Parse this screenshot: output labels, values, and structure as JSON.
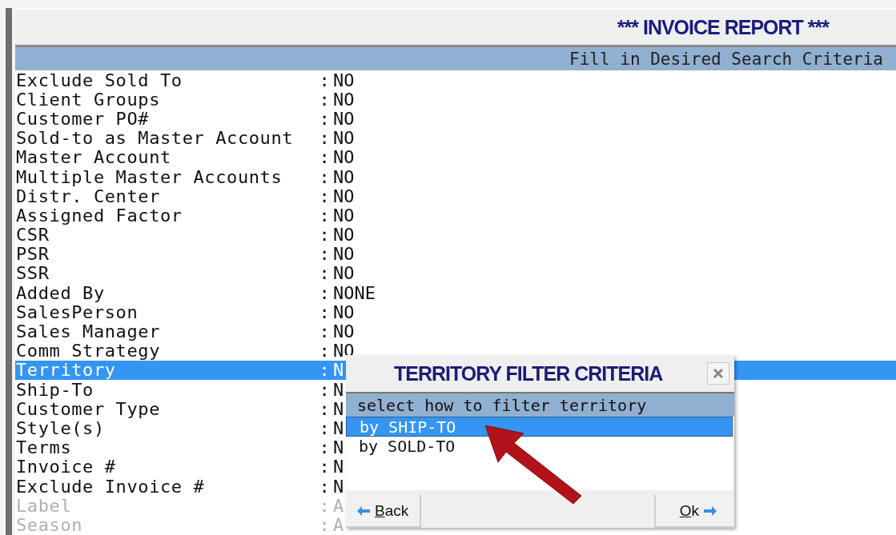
{
  "header": {
    "title": "*** INVOICE REPORT ***",
    "subtitle": "Fill in Desired Search Criteria"
  },
  "fields": [
    {
      "label": "Exclude Sold To",
      "separator": ":",
      "value": "NO",
      "selected": false,
      "disabled": false
    },
    {
      "label": "Client Groups",
      "separator": ":",
      "value": "NO",
      "selected": false,
      "disabled": false
    },
    {
      "label": "Customer PO#",
      "separator": ":",
      "value": "NO",
      "selected": false,
      "disabled": false
    },
    {
      "label": "Sold-to as Master Account",
      "separator": ":",
      "value": "NO",
      "selected": false,
      "disabled": false
    },
    {
      "label": "Master Account",
      "separator": ":",
      "value": "NO",
      "selected": false,
      "disabled": false
    },
    {
      "label": "Multiple Master Accounts",
      "separator": ":",
      "value": "NO",
      "selected": false,
      "disabled": false
    },
    {
      "label": "Distr. Center",
      "separator": ":",
      "value": "NO",
      "selected": false,
      "disabled": false
    },
    {
      "label": "Assigned Factor",
      "separator": ":",
      "value": "NO",
      "selected": false,
      "disabled": false
    },
    {
      "label": "CSR",
      "separator": ":",
      "value": "NO",
      "selected": false,
      "disabled": false
    },
    {
      "label": "PSR",
      "separator": ":",
      "value": "NO",
      "selected": false,
      "disabled": false
    },
    {
      "label": "SSR",
      "separator": ":",
      "value": "NO",
      "selected": false,
      "disabled": false
    },
    {
      "label": "Added By",
      "separator": ":",
      "value": "NONE",
      "selected": false,
      "disabled": false
    },
    {
      "label": "SalesPerson",
      "separator": ":",
      "value": "NO",
      "selected": false,
      "disabled": false
    },
    {
      "label": "Sales Manager",
      "separator": ":",
      "value": "NO",
      "selected": false,
      "disabled": false
    },
    {
      "label": "Comm Strategy",
      "separator": ":",
      "value": "NO",
      "selected": false,
      "disabled": false
    },
    {
      "label": "Territory",
      "separator": ":",
      "value": "N",
      "selected": true,
      "disabled": false
    },
    {
      "label": "Ship-To",
      "separator": ":",
      "value": "N",
      "selected": false,
      "disabled": false
    },
    {
      "label": "Customer Type",
      "separator": ":",
      "value": "N",
      "selected": false,
      "disabled": false
    },
    {
      "label": "Style(s)",
      "separator": ":",
      "value": "N",
      "selected": false,
      "disabled": false
    },
    {
      "label": "Terms",
      "separator": ":",
      "value": "N",
      "selected": false,
      "disabled": false
    },
    {
      "label": "Invoice #",
      "separator": ":",
      "value": "N",
      "selected": false,
      "disabled": false
    },
    {
      "label": "Exclude Invoice #",
      "separator": ":",
      "value": "N",
      "selected": false,
      "disabled": false
    },
    {
      "label": "Label",
      "separator": ":",
      "value": "A",
      "selected": false,
      "disabled": true
    },
    {
      "label": "Season",
      "separator": ":",
      "value": "A",
      "selected": false,
      "disabled": true
    }
  ],
  "dialog": {
    "title": "TERRITORY FILTER CRITERIA",
    "prompt": "select how to filter territory",
    "options": [
      {
        "label": "by SHIP-TO",
        "selected": true
      },
      {
        "label": "by SOLD-TO",
        "selected": false
      }
    ],
    "buttons": [
      {
        "label": "Back",
        "kind": "back"
      },
      {
        "label": "Ok",
        "kind": "ok"
      }
    ]
  }
}
